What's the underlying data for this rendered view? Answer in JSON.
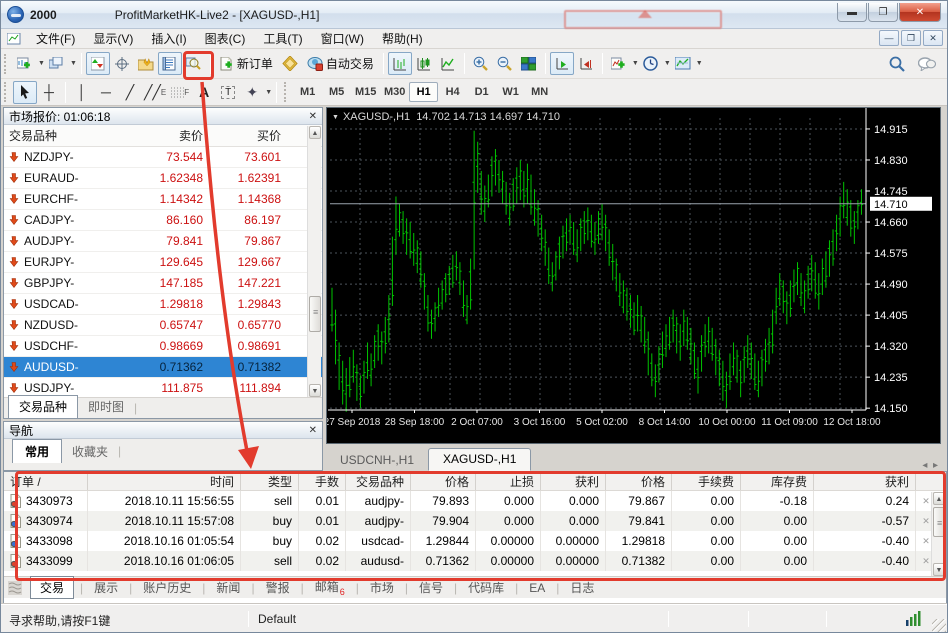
{
  "window": {
    "account": "2000",
    "title": "ProfitMarketHK-Live2 - [XAGUSD-,H1]"
  },
  "menu": {
    "items": [
      "文件(F)",
      "显示(V)",
      "插入(I)",
      "图表(C)",
      "工具(T)",
      "窗口(W)",
      "帮助(H)"
    ]
  },
  "toolbar": {
    "new_order_label": "新订单",
    "autotrading_label": "自动交易",
    "draw_labels": {
      "channel": "E",
      "fibo": "F",
      "text": "A",
      "textbox": "T"
    },
    "timeframes": [
      "M1",
      "M5",
      "M15",
      "M30",
      "H1",
      "H4",
      "D1",
      "W1",
      "MN"
    ],
    "active_timeframe": "H1",
    "icons": [
      "new-chart",
      "profiles",
      "market-watch",
      "data-window",
      "navigator",
      "terminal",
      "strategy-tester",
      "new-order",
      "metaeditor",
      "autotrading",
      "bar-chart",
      "candlestick-chart",
      "line-chart",
      "zoom-in",
      "zoom-out",
      "tile-windows",
      "auto-scroll",
      "chart-shift",
      "indicators",
      "periods",
      "templates",
      "search",
      "chat"
    ]
  },
  "market_watch": {
    "title": "市场报价: 01:06:18",
    "columns": [
      "交易品种",
      "卖价",
      "买价"
    ],
    "selected_symbol": "AUDUSD-",
    "rows": [
      {
        "symbol": "NZDJPY-",
        "bid": "73.544",
        "ask": "73.601"
      },
      {
        "symbol": "EURAUD-",
        "bid": "1.62348",
        "ask": "1.62391"
      },
      {
        "symbol": "EURCHF-",
        "bid": "1.14342",
        "ask": "1.14368"
      },
      {
        "symbol": "CADJPY-",
        "bid": "86.160",
        "ask": "86.197"
      },
      {
        "symbol": "AUDJPY-",
        "bid": "79.841",
        "ask": "79.867"
      },
      {
        "symbol": "EURJPY-",
        "bid": "129.645",
        "ask": "129.667"
      },
      {
        "symbol": "GBPJPY-",
        "bid": "147.185",
        "ask": "147.221"
      },
      {
        "symbol": "USDCAD-",
        "bid": "1.29818",
        "ask": "1.29843"
      },
      {
        "symbol": "NZDUSD-",
        "bid": "0.65747",
        "ask": "0.65770"
      },
      {
        "symbol": "USDCHF-",
        "bid": "0.98669",
        "ask": "0.98691"
      },
      {
        "symbol": "AUDUSD-",
        "bid": "0.71362",
        "ask": "0.71382"
      },
      {
        "symbol": "USDJPY-",
        "bid": "111.875",
        "ask": "111.894"
      }
    ],
    "tabs": [
      "交易品种",
      "即时图"
    ],
    "active_tab": "交易品种"
  },
  "navigator": {
    "title": "导航",
    "tabs": [
      "常用",
      "收藏夹"
    ],
    "active_tab": "常用"
  },
  "chart_tabs": {
    "items": [
      "USDCNH-,H1",
      "XAGUSD-,H1"
    ],
    "active": "XAGUSD-,H1"
  },
  "chart_data": {
    "type": "ohlc-bar",
    "symbol": "XAGUSD-",
    "timeframe": "H1",
    "title": "XAGUSD-,H1",
    "ohlc_readout": "14.702 14.713 14.697 14.710",
    "current_price": "14.710",
    "y_ticks": [
      "14.915",
      "14.830",
      "14.745",
      "14.660",
      "14.575",
      "14.490",
      "14.405",
      "14.320",
      "14.235",
      "14.150"
    ],
    "x_labels": [
      "27 Sep 2018",
      "28 Sep 18:00",
      "2 Oct 07:00",
      "3 Oct 16:00",
      "5 Oct 02:00",
      "8 Oct 14:00",
      "10 Oct 00:00",
      "11 Oct 09:00",
      "12 Oct 18:00"
    ],
    "y_range": [
      14.145,
      14.945
    ],
    "bar_color": "#00c400",
    "background": "#000000",
    "grid": true,
    "bars_high_low": [
      [
        14.48,
        14.36
      ],
      [
        14.42,
        14.27
      ],
      [
        14.33,
        14.2
      ],
      [
        14.28,
        14.16
      ],
      [
        14.26,
        14.14
      ],
      [
        14.29,
        14.18
      ],
      [
        14.31,
        14.22
      ],
      [
        14.27,
        14.17
      ],
      [
        14.24,
        14.15
      ],
      [
        14.28,
        14.19
      ],
      [
        14.33,
        14.23
      ],
      [
        14.3,
        14.21
      ],
      [
        14.35,
        14.26
      ],
      [
        14.38,
        14.28
      ],
      [
        14.36,
        14.27
      ],
      [
        14.4,
        14.3
      ],
      [
        14.46,
        14.33
      ],
      [
        14.62,
        14.43
      ],
      [
        14.73,
        14.57
      ],
      [
        14.71,
        14.62
      ],
      [
        14.69,
        14.6
      ],
      [
        14.67,
        14.57
      ],
      [
        14.66,
        14.56
      ],
      [
        14.63,
        14.54
      ],
      [
        14.61,
        14.52
      ],
      [
        14.58,
        14.48
      ],
      [
        14.52,
        14.42
      ],
      [
        14.46,
        14.36
      ],
      [
        14.42,
        14.34
      ],
      [
        14.44,
        14.36
      ],
      [
        14.48,
        14.4
      ],
      [
        14.5,
        14.42
      ],
      [
        14.52,
        14.44
      ],
      [
        14.54,
        14.46
      ],
      [
        14.57,
        14.48
      ],
      [
        14.58,
        14.5
      ],
      [
        14.55,
        14.46
      ],
      [
        14.5,
        14.4
      ],
      [
        14.46,
        14.38
      ],
      [
        14.56,
        14.42
      ],
      [
        14.91,
        14.53
      ],
      [
        14.88,
        14.74
      ],
      [
        14.8,
        14.68
      ],
      [
        14.76,
        14.66
      ],
      [
        14.79,
        14.7
      ],
      [
        14.84,
        14.73
      ],
      [
        14.86,
        14.76
      ],
      [
        14.83,
        14.74
      ],
      [
        14.8,
        14.71
      ],
      [
        14.77,
        14.68
      ],
      [
        14.74,
        14.65
      ],
      [
        14.78,
        14.69
      ],
      [
        14.81,
        14.71
      ],
      [
        14.83,
        14.72
      ],
      [
        14.8,
        14.7
      ],
      [
        14.82,
        14.71
      ],
      [
        14.79,
        14.68
      ],
      [
        14.75,
        14.65
      ],
      [
        14.72,
        14.62
      ],
      [
        14.68,
        14.58
      ],
      [
        14.64,
        14.54
      ],
      [
        14.59,
        14.49
      ],
      [
        14.55,
        14.47
      ],
      [
        14.58,
        14.5
      ],
      [
        14.62,
        14.53
      ],
      [
        14.65,
        14.56
      ],
      [
        14.67,
        14.58
      ],
      [
        14.68,
        14.6
      ],
      [
        14.66,
        14.57
      ],
      [
        14.64,
        14.55
      ],
      [
        14.67,
        14.58
      ],
      [
        14.69,
        14.6
      ],
      [
        14.7,
        14.61
      ],
      [
        14.68,
        14.59
      ],
      [
        14.66,
        14.57
      ],
      [
        14.69,
        14.6
      ],
      [
        14.71,
        14.61
      ],
      [
        14.68,
        14.58
      ],
      [
        14.64,
        14.54
      ],
      [
        14.6,
        14.5
      ],
      [
        14.56,
        14.47
      ],
      [
        14.52,
        14.43
      ],
      [
        14.5,
        14.41
      ],
      [
        14.48,
        14.39
      ],
      [
        14.46,
        14.37
      ],
      [
        14.44,
        14.35
      ],
      [
        14.46,
        14.36
      ],
      [
        14.43,
        14.33
      ],
      [
        14.4,
        14.3
      ],
      [
        14.36,
        14.24
      ],
      [
        14.3,
        14.21
      ],
      [
        14.27,
        14.18
      ],
      [
        14.32,
        14.22
      ],
      [
        14.36,
        14.26
      ],
      [
        14.38,
        14.29
      ],
      [
        14.4,
        14.31
      ],
      [
        14.42,
        14.33
      ],
      [
        14.4,
        14.3
      ],
      [
        14.38,
        14.28
      ],
      [
        14.42,
        14.32
      ],
      [
        14.4,
        14.31
      ],
      [
        14.37,
        14.27
      ],
      [
        14.33,
        14.23
      ],
      [
        14.29,
        14.19
      ],
      [
        14.35,
        14.25
      ],
      [
        14.38,
        14.29
      ],
      [
        14.4,
        14.3
      ],
      [
        14.37,
        14.28
      ],
      [
        14.34,
        14.24
      ],
      [
        14.31,
        14.21
      ],
      [
        14.28,
        14.17
      ],
      [
        14.25,
        14.15
      ],
      [
        14.3,
        14.2
      ],
      [
        14.33,
        14.24
      ],
      [
        14.31,
        14.22
      ],
      [
        14.28,
        14.18
      ],
      [
        14.32,
        14.22
      ],
      [
        14.35,
        14.26
      ],
      [
        14.33,
        14.23
      ],
      [
        14.3,
        14.2
      ],
      [
        14.28,
        14.18
      ],
      [
        14.31,
        14.21
      ],
      [
        14.34,
        14.25
      ],
      [
        14.37,
        14.27
      ],
      [
        14.42,
        14.3
      ],
      [
        14.48,
        14.38
      ],
      [
        14.52,
        14.43
      ],
      [
        14.5,
        14.41
      ],
      [
        14.47,
        14.38
      ],
      [
        14.5,
        14.4
      ],
      [
        14.53,
        14.44
      ],
      [
        14.55,
        14.46
      ],
      [
        14.52,
        14.43
      ],
      [
        14.5,
        14.41
      ],
      [
        14.54,
        14.45
      ],
      [
        14.57,
        14.47
      ],
      [
        14.55,
        14.45
      ],
      [
        14.52,
        14.42
      ],
      [
        14.56,
        14.46
      ],
      [
        14.58,
        14.48
      ],
      [
        14.61,
        14.51
      ],
      [
        14.64,
        14.54
      ],
      [
        14.68,
        14.58
      ],
      [
        14.73,
        14.62
      ],
      [
        14.77,
        14.67
      ],
      [
        14.75,
        14.65
      ],
      [
        14.72,
        14.62
      ],
      [
        14.69,
        14.6
      ],
      [
        14.72,
        14.64
      ],
      [
        14.75,
        14.68
      ]
    ]
  },
  "terminal": {
    "columns": [
      "订单 /",
      "时间",
      "类型",
      "手数",
      "交易品种",
      "价格",
      "止损",
      "获利",
      "价格",
      "手续费",
      "库存费",
      "获利"
    ],
    "rows": [
      {
        "order": "3430973",
        "time": "2018.10.11 15:56:55",
        "type": "sell",
        "lots": "0.01",
        "symbol": "audjpy-",
        "price": "79.893",
        "sl": "0.000",
        "tp": "0.000",
        "price2": "79.867",
        "commission": "0.00",
        "swap": "-0.18",
        "profit": "0.24"
      },
      {
        "order": "3430974",
        "time": "2018.10.11 15:57:08",
        "type": "buy",
        "lots": "0.01",
        "symbol": "audjpy-",
        "price": "79.904",
        "sl": "0.000",
        "tp": "0.000",
        "price2": "79.841",
        "commission": "0.00",
        "swap": "0.00",
        "profit": "-0.57"
      },
      {
        "order": "3433098",
        "time": "2018.10.16 01:05:54",
        "type": "buy",
        "lots": "0.02",
        "symbol": "usdcad-",
        "price": "1.29844",
        "sl": "0.00000",
        "tp": "0.00000",
        "price2": "1.29818",
        "commission": "0.00",
        "swap": "0.00",
        "profit": "-0.40"
      },
      {
        "order": "3433099",
        "time": "2018.10.16 01:06:05",
        "type": "sell",
        "lots": "0.02",
        "symbol": "audusd-",
        "price": "0.71362",
        "sl": "0.00000",
        "tp": "0.00000",
        "price2": "0.71382",
        "commission": "0.00",
        "swap": "0.00",
        "profit": "-0.40"
      }
    ],
    "tabs": [
      "交易",
      "展示",
      "账户历史",
      "新闻",
      "警报",
      "邮箱",
      "市场",
      "信号",
      "代码库",
      "EA",
      "日志"
    ],
    "active_tab": "交易",
    "mail_badge": "6"
  },
  "status_bar": {
    "help": "寻求帮助,请按F1键",
    "profile": "Default"
  },
  "annotations": {
    "color": "#e23b2d",
    "callout_number": "6"
  }
}
